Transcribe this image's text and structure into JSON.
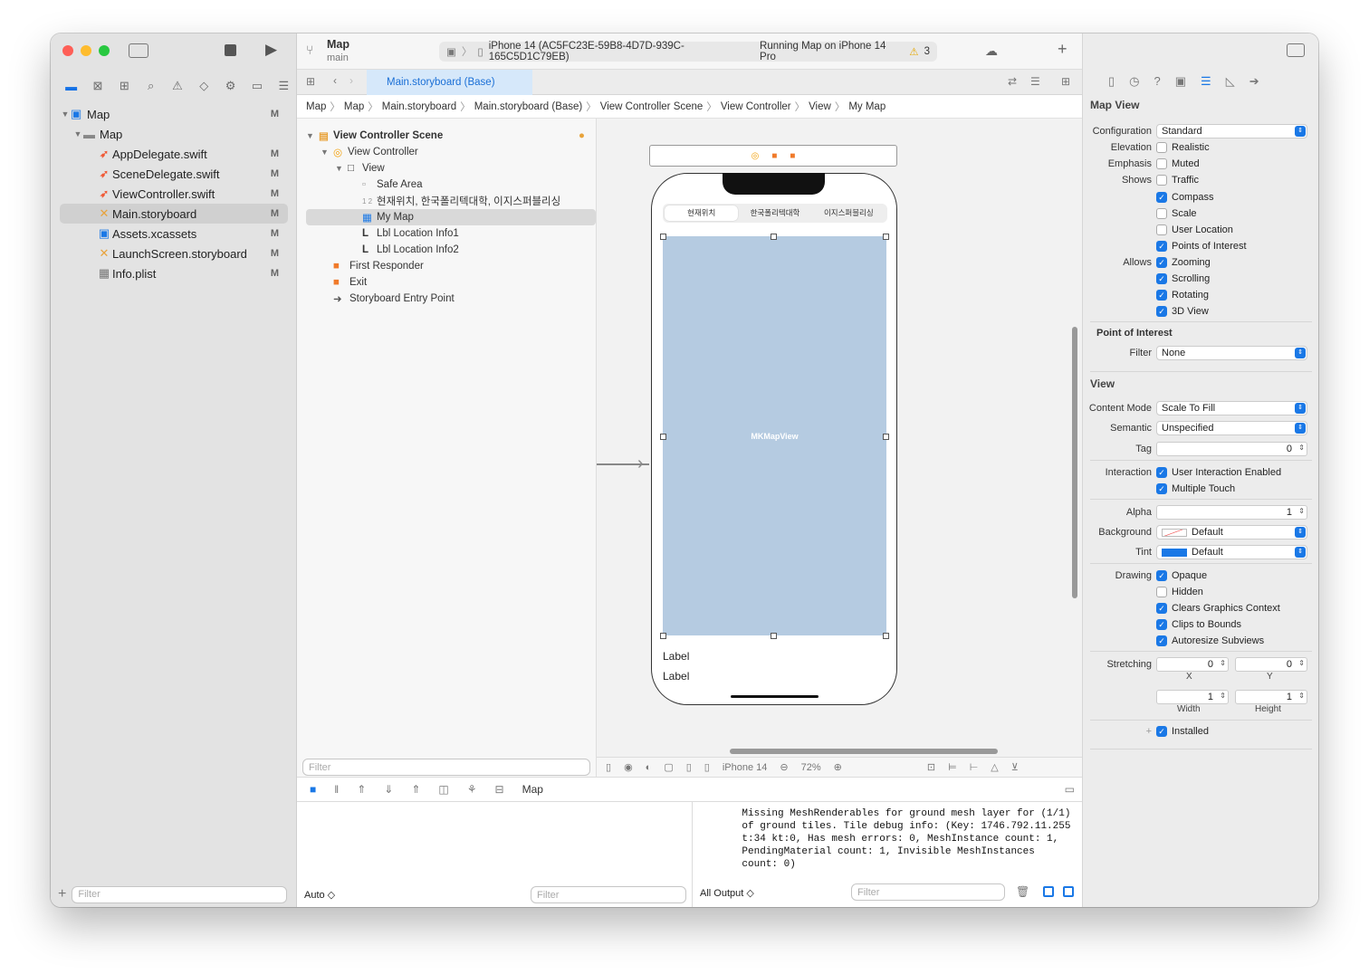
{
  "toolbar": {
    "scheme_title": "Map",
    "scheme_branch": "main",
    "device": "iPhone 14 (AC5FC23E-59B8-4D7D-939C-165C5D1C79EB)",
    "status": "Running Map on iPhone 14 Pro",
    "warnings": "3"
  },
  "tab": {
    "label": "Main.storyboard (Base)"
  },
  "jump": [
    "Map",
    "Map",
    "Main.storyboard",
    "Main.storyboard (Base)",
    "View Controller Scene",
    "View Controller",
    "View",
    "My Map"
  ],
  "navigator": {
    "project": "Map",
    "group": "Map",
    "files": [
      {
        "name": "AppDelegate.swift",
        "status": "M"
      },
      {
        "name": "SceneDelegate.swift",
        "status": "M"
      },
      {
        "name": "ViewController.swift",
        "status": "M"
      },
      {
        "name": "Main.storyboard",
        "status": "M"
      },
      {
        "name": "Assets.xcassets",
        "status": "M"
      },
      {
        "name": "LaunchScreen.storyboard",
        "status": "M"
      },
      {
        "name": "Info.plist",
        "status": "M"
      }
    ],
    "project_status": "M",
    "group_status": "M",
    "filter_placeholder": "Filter"
  },
  "outline": {
    "scene": "View Controller Scene",
    "vc": "View Controller",
    "view": "View",
    "items": [
      "Safe Area",
      "현재위치, 한국폴리텍대학, 이지스퍼블리싱",
      "My Map",
      "Lbl Location Info1",
      "Lbl Location Info2"
    ],
    "first_responder": "First Responder",
    "exit": "Exit",
    "entry": "Storyboard Entry Point",
    "filter_placeholder": "Filter"
  },
  "canvas": {
    "segments": [
      "현재위치",
      "한국폴리텍대학",
      "이지스퍼블리싱"
    ],
    "map_label": "MKMapView",
    "label1": "Label",
    "label2": "Label",
    "device": "iPhone 14",
    "zoom": "72%"
  },
  "debug": {
    "target": "Map",
    "auto": "Auto ◇",
    "filter_placeholder": "Filter",
    "output": "All Output ◇",
    "output_filter": "Filter",
    "console": "    Missing MeshRenderables for ground mesh layer for (1/1)\n    of ground tiles. Tile debug info: (Key: 1746.792.11.255\n    t:34 kt:0, Has mesh errors: 0, MeshInstance count: 1,\n    PendingMaterial count: 1, Invisible MeshInstances\n    count: 0)"
  },
  "inspector": {
    "title": "Map View",
    "configuration_label": "Configuration",
    "configuration": "Standard",
    "elevation_label": "Elevation",
    "elevation": "Realistic",
    "emphasis_label": "Emphasis",
    "emphasis": "Muted",
    "shows_label": "Shows",
    "shows": [
      {
        "label": "Traffic",
        "on": false
      },
      {
        "label": "Compass",
        "on": true
      },
      {
        "label": "Scale",
        "on": false
      },
      {
        "label": "User Location",
        "on": false
      },
      {
        "label": "Points of Interest",
        "on": true
      }
    ],
    "allows_label": "Allows",
    "allows": [
      {
        "label": "Zooming",
        "on": true
      },
      {
        "label": "Scrolling",
        "on": true
      },
      {
        "label": "Rotating",
        "on": true
      },
      {
        "label": "3D View",
        "on": true
      }
    ],
    "poi_title": "Point of Interest",
    "filter_label": "Filter",
    "filter": "None",
    "view_title": "View",
    "content_mode_label": "Content Mode",
    "content_mode": "Scale To Fill",
    "semantic_label": "Semantic",
    "semantic": "Unspecified",
    "tag_label": "Tag",
    "tag": "0",
    "interaction_label": "Interaction",
    "interaction": [
      {
        "label": "User Interaction Enabled",
        "on": true
      },
      {
        "label": "Multiple Touch",
        "on": true
      }
    ],
    "alpha_label": "Alpha",
    "alpha": "1",
    "background_label": "Background",
    "background": "Default",
    "tint_label": "Tint",
    "tint": "Default",
    "drawing_label": "Drawing",
    "drawing": [
      {
        "label": "Opaque",
        "on": true
      },
      {
        "label": "Hidden",
        "on": false
      },
      {
        "label": "Clears Graphics Context",
        "on": true
      },
      {
        "label": "Clips to Bounds",
        "on": true
      },
      {
        "label": "Autoresize Subviews",
        "on": true
      }
    ],
    "stretching_label": "Stretching",
    "stretch_x": "0",
    "stretch_y": "0",
    "stretch_w": "1",
    "stretch_h": "1",
    "x_lbl": "X",
    "y_lbl": "Y",
    "w_lbl": "Width",
    "h_lbl": "Height",
    "installed": "Installed"
  },
  "colors": {
    "accent": "#1a78e6",
    "map": "#b5cbe1"
  }
}
